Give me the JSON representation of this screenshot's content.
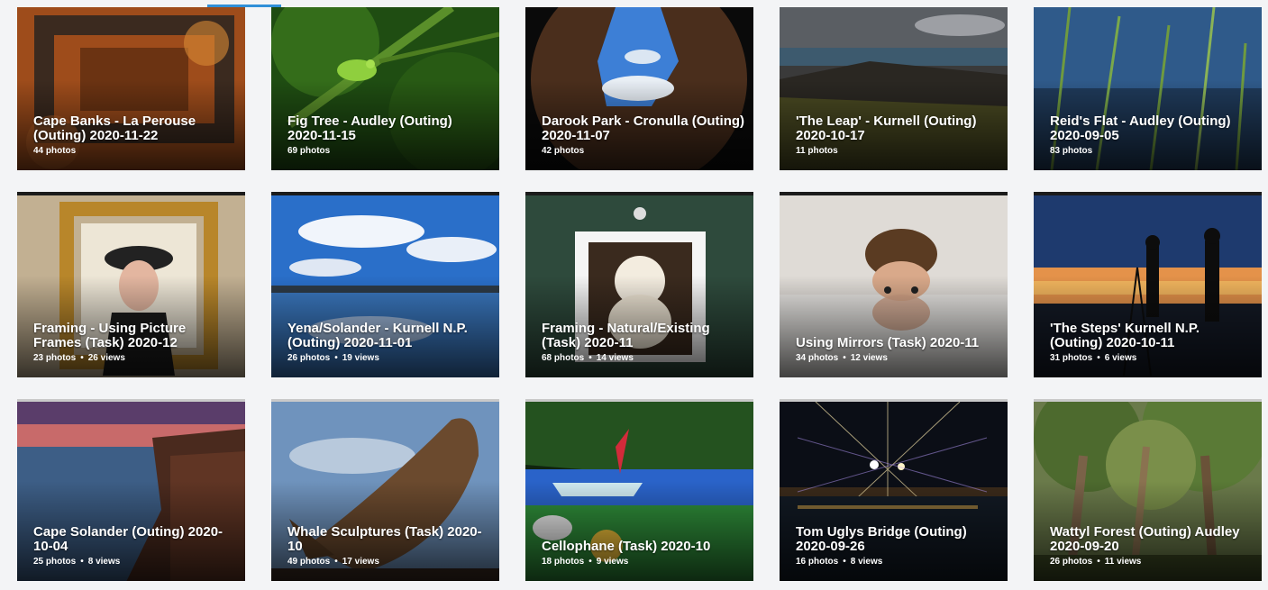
{
  "tab_indicator_color": "#2f8fd8",
  "albums": [
    {
      "title": "Cape Banks - La Perouse (Outing) 2020-11-22",
      "photos": "44 photos",
      "views": "",
      "photo_icon": "rusty-frame-photo"
    },
    {
      "title": "Fig Tree - Audley (Outing) 2020-11-15",
      "photos": "69 photos",
      "views": "",
      "photo_icon": "frog-on-branch-photo"
    },
    {
      "title": "Darook Park - Cronulla (Outing) 2020-11-07",
      "photos": "42 photos",
      "views": "",
      "photo_icon": "rock-arch-sky-photo"
    },
    {
      "title": "'The Leap' - Kurnell (Outing) 2020-10-17",
      "photos": "11 photos",
      "views": "",
      "photo_icon": "coastal-cliff-photo"
    },
    {
      "title": "Reid's Flat - Audley (Outing) 2020-09-05",
      "photos": "83 photos",
      "views": "",
      "photo_icon": "dewy-grass-photo"
    },
    {
      "title": "Framing - Using Picture Frames (Task) 2020-12",
      "photos": "23 photos",
      "views": "26 views",
      "photo_icon": "girl-picture-frame-photo"
    },
    {
      "title": "Yena/Solander - Kurnell N.P. (Outing) 2020-11-01",
      "photos": "26 photos",
      "views": "19 views",
      "photo_icon": "sky-reflection-photo"
    },
    {
      "title": "Framing - Natural/Existing (Task) 2020-11",
      "photos": "68 photos",
      "views": "14 views",
      "photo_icon": "puppy-window-photo"
    },
    {
      "title": "Using Mirrors (Task) 2020-11",
      "photos": "34 photos",
      "views": "12 views",
      "photo_icon": "mirror-face-photo"
    },
    {
      "title": "'The Steps' Kurnell N.P. (Outing) 2020-10-11",
      "photos": "31 photos",
      "views": "6 views",
      "photo_icon": "sunset-silhouettes-photo"
    },
    {
      "title": "Cape Solander (Outing) 2020-10-04",
      "photos": "25 photos",
      "views": "8 views",
      "photo_icon": "cliff-sunrise-photo"
    },
    {
      "title": "Whale Sculptures (Task) 2020-10",
      "photos": "49 photos",
      "views": "17 views",
      "photo_icon": "whale-sculpture-photo"
    },
    {
      "title": "Cellophane (Task) 2020-10",
      "photos": "18 photos",
      "views": "9 views",
      "photo_icon": "toy-boat-photo"
    },
    {
      "title": "Tom Uglys Bridge (Outing) 2020-09-26",
      "photos": "16 photos",
      "views": "8 views",
      "photo_icon": "bridge-night-lights-photo"
    },
    {
      "title": "Wattyl Forest (Outing) Audley 2020-09-20",
      "photos": "26 photos",
      "views": "11 views",
      "photo_icon": "forest-trees-photo"
    }
  ]
}
